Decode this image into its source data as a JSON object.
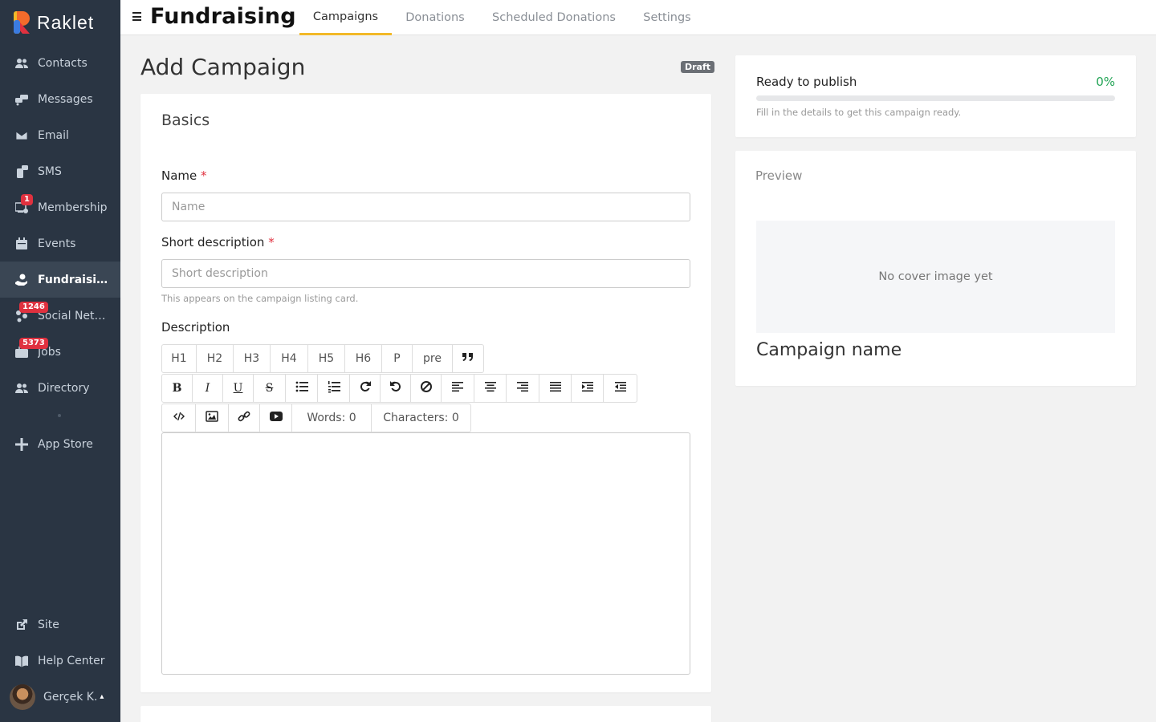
{
  "app": {
    "name": "Raklet",
    "page_title": "Fundraising"
  },
  "sidebar": {
    "items": [
      {
        "label": "Contacts",
        "icon": "contacts-icon"
      },
      {
        "label": "Messages",
        "icon": "messages-icon"
      },
      {
        "label": "Email",
        "icon": "email-icon"
      },
      {
        "label": "SMS",
        "icon": "sms-icon"
      },
      {
        "label": "Membership",
        "icon": "membership-icon",
        "badge": "1"
      },
      {
        "label": "Events",
        "icon": "calendar-icon"
      },
      {
        "label": "Fundraising",
        "icon": "fundraising-icon",
        "active": true
      },
      {
        "label": "Social Netw...",
        "icon": "social-network-icon",
        "badge": "1246"
      },
      {
        "label": "Jobs",
        "icon": "jobs-icon",
        "badge": "5373"
      },
      {
        "label": "Directory",
        "icon": "directory-icon"
      },
      {
        "label": "App Store",
        "icon": "plus-icon"
      }
    ],
    "bottom": [
      {
        "label": "Site",
        "icon": "external-link-icon"
      },
      {
        "label": "Help Center",
        "icon": "book-icon"
      }
    ],
    "user": {
      "name": "Gerçek K.",
      "caret": "▴"
    }
  },
  "tabs": [
    {
      "label": "Campaigns",
      "active": true
    },
    {
      "label": "Donations"
    },
    {
      "label": "Scheduled Donations"
    },
    {
      "label": "Settings"
    }
  ],
  "form": {
    "heading": "Add Campaign",
    "status_badge": "Draft",
    "section_title": "Basics",
    "name_label": "Name",
    "name_placeholder": "Name",
    "name_value": "",
    "short_desc_label": "Short description",
    "short_desc_placeholder": "Short description",
    "short_desc_value": "",
    "short_desc_hint": "This appears on the campaign listing card.",
    "description_label": "Description",
    "required_mark": "*",
    "toolbar": {
      "headings": [
        "H1",
        "H2",
        "H3",
        "H4",
        "H5",
        "H6",
        "P",
        "pre"
      ],
      "words": "Words: 0",
      "characters": "Characters: 0"
    }
  },
  "publish": {
    "title": "Ready to publish",
    "percent_text": "0%",
    "progress": 0,
    "hint": "Fill in the details to get this campaign ready."
  },
  "preview": {
    "label": "Preview",
    "no_cover": "No cover image yet",
    "campaign_name": "Campaign name"
  },
  "colors": {
    "sidebar_bg": "#2a3543",
    "accent_tab": "#f2b928",
    "success": "#22a455",
    "required": "#e0313f"
  }
}
